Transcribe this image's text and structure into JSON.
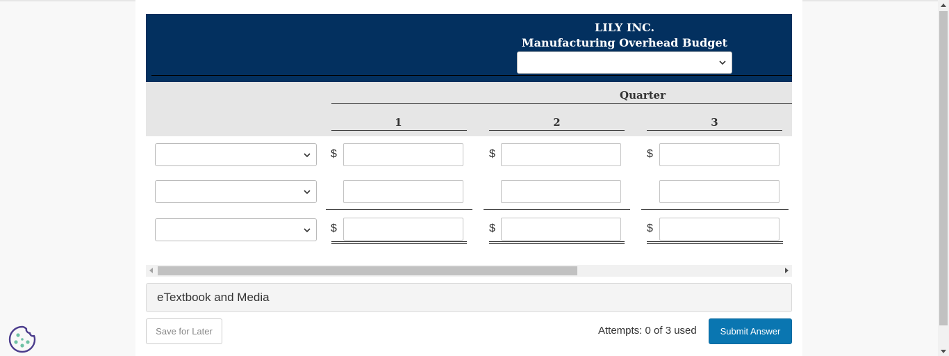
{
  "header": {
    "company": "LILY INC.",
    "title": "Manufacturing Overhead Budget",
    "period_select_value": ""
  },
  "subheader": {
    "quarter_label": "Quarter",
    "quarters": [
      "1",
      "2",
      "3"
    ]
  },
  "rows": [
    {
      "label_select_value": "",
      "currency_symbol": "$",
      "values": [
        "",
        "",
        ""
      ]
    },
    {
      "label_select_value": "",
      "currency_symbol": "",
      "values": [
        "",
        "",
        ""
      ]
    },
    {
      "label_select_value": "",
      "currency_symbol": "$",
      "values": [
        "",
        "",
        ""
      ]
    }
  ],
  "etextbook": {
    "label": "eTextbook and Media"
  },
  "footer": {
    "save_label": "Save for Later",
    "attempts_text": "Attempts: 0 of 3 used",
    "submit_label": "Submit Answer"
  },
  "colors": {
    "header_bg": "#03305f",
    "subheader_bg": "#e6e6e6",
    "submit_bg": "#0a76b1"
  },
  "icons": [
    "chevron-down-icon",
    "cookie-icon",
    "scroll-left-arrow",
    "scroll-right-arrow"
  ]
}
